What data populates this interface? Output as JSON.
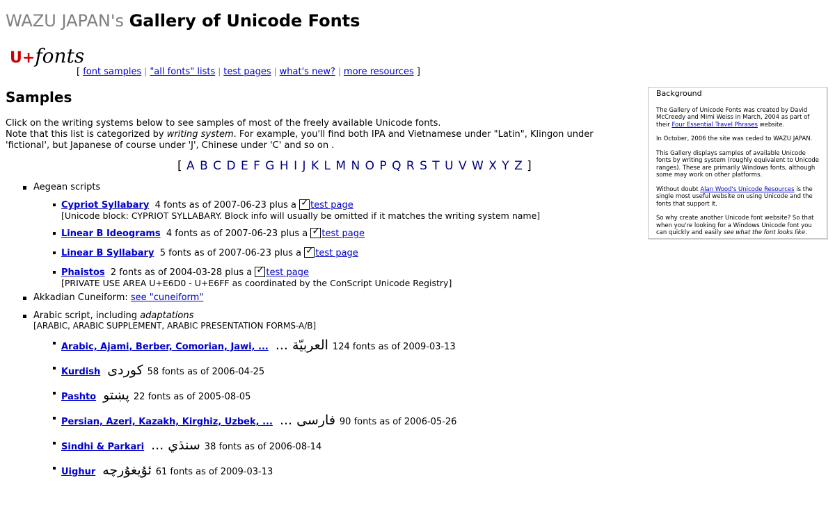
{
  "header": {
    "brand": "WAZU JAPAN's",
    "title": "Gallery of Unicode Fonts",
    "logo_prefix": "U+",
    "logo_word": "fonts"
  },
  "nav": {
    "open": "[",
    "close": "]",
    "separator": "|",
    "items": [
      "font samples",
      "\"all fonts\" lists",
      "test pages",
      "what's new?",
      "more resources"
    ]
  },
  "samples": {
    "heading": "Samples",
    "intro_line1": "Click on the writing systems below to see samples of most of the freely available Unicode fonts.",
    "intro_line2_a": "Note that this list is categorized by ",
    "intro_line2_em": "writing system",
    "intro_line2_b": ". For example, you'll find both IPA and Vietnamese under \"Latin\", Klingon under 'fictional', but Japanese of course under 'J', Chinese under 'C' and so on ."
  },
  "alphabet": {
    "open": "[",
    "close": "]",
    "letters": [
      "A",
      "B",
      "C",
      "D",
      "E",
      "F",
      "G",
      "H",
      "I",
      "J",
      "K",
      "L",
      "M",
      "N",
      "O",
      "P",
      "Q",
      "R",
      "S",
      "T",
      "U",
      "V",
      "W",
      "X",
      "Y",
      "Z"
    ]
  },
  "background": {
    "title": "Background",
    "p1_a": "The Gallery of Unicode Fonts was created by David McCreedy and Mimi Weiss in March, 2004 as part of their ",
    "p1_link": "Four Essential Travel Phrases",
    "p1_b": " website.",
    "p2": "In October, 2006 the site was ceded to WAZU JAPAN.",
    "p3": "This Gallery displays samples of available Unicode fonts by writing system (roughly equivalent to Unicode ranges). These are primarily Windows fonts, although some may work on other platforms.",
    "p4_a": "Without doubt ",
    "p4_link": "Alan Wood's Unicode Resources",
    "p4_b": " is the single most useful website on using Unicode and the fonts that support it.",
    "p5_a": "So why create another Unicode font website? So that when you're looking for a Windows Unicode font you can quickly and easily ",
    "p5_em": "see what the font looks like",
    "p5_b": "."
  },
  "list": {
    "aegean": {
      "label": "Aegean scripts",
      "items": [
        {
          "name": "Cypriot Syllabary",
          "info": "4 fonts as of 2007-06-23 plus a",
          "test": "test page",
          "note": "[Unicode block: CYPRIOT SYLLABARY. Block info will usually be omitted if it matches the writing system name]"
        },
        {
          "name": "Linear B Ideograms",
          "info": "4 fonts as of 2007-06-23 plus a",
          "test": "test page"
        },
        {
          "name": "Linear B Syllabary",
          "info": "5 fonts as of 2007-06-23 plus a",
          "test": "test page"
        },
        {
          "name": "Phaistos",
          "info": "2 fonts as of 2004-03-28 plus a",
          "test": "test page",
          "note": "[PRIVATE USE AREA U+E6D0 - U+E6FF as coordinated by the ConScript Unicode Registry]"
        }
      ]
    },
    "akkadian": {
      "label": "Akkadian Cuneiform:",
      "link": "see \"cuneiform\""
    },
    "arabic": {
      "label_a": "Arabic script, including ",
      "label_em": "adaptations",
      "blocks": "[ARABIC, ARABIC SUPPLEMENT, ARABIC PRESENTATION FORMS-A/B]",
      "items": [
        {
          "name": "Arabic, Ajami, Berber, Comorian, Jawi, ...",
          "script": "العربيّة ...",
          "info": "124 fonts as of 2009-03-13"
        },
        {
          "name": "Kurdish",
          "script": "کوردی",
          "info": "58 fonts as of 2006-04-25"
        },
        {
          "name": "Pashto",
          "script": "پښتو",
          "info": "22 fonts as of 2005-08-05"
        },
        {
          "name": "Persian, Azeri, Kazakh, Kirghiz, Uzbek, ...",
          "script": "فارسی ...",
          "info": "90 fonts as of 2006-05-26"
        },
        {
          "name": "Sindhi & Parkari",
          "script": "سنڌي ...",
          "info": "38 fonts as of 2006-08-14"
        },
        {
          "name": "Uighur",
          "script": "ئۇيغۇرچە",
          "info": "61 fonts as of 2009-03-13"
        }
      ]
    }
  }
}
